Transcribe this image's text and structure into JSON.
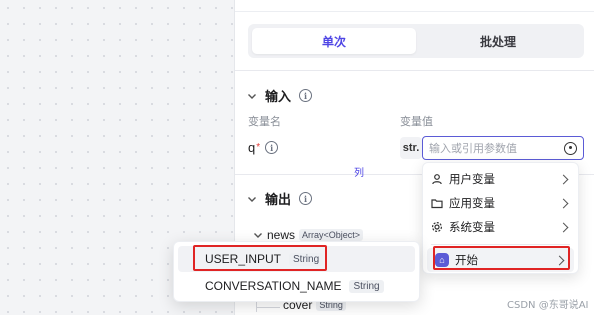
{
  "tabs": {
    "single": "单次",
    "batch": "批处理"
  },
  "input_section": {
    "title": "输入",
    "col_name": "变量名",
    "col_value": "变量值",
    "var_name": "q",
    "required_mark": "*",
    "type_chip": "str.",
    "placeholder": "输入或引用参数值"
  },
  "output_section": {
    "title": "输出",
    "partial_link": "列",
    "rows": [
      {
        "name": "news",
        "type": "Array<Object>"
      },
      {
        "name": "cover",
        "type": "String"
      }
    ]
  },
  "dropdown": {
    "items": [
      {
        "label": "用户变量",
        "icon": "user-icon"
      },
      {
        "label": "应用变量",
        "icon": "folder-icon"
      },
      {
        "label": "系统变量",
        "icon": "gear-icon"
      },
      {
        "label": "开始",
        "icon": "start-node-icon"
      }
    ]
  },
  "popover": {
    "items": [
      {
        "name": "USER_INPUT",
        "type": "String"
      },
      {
        "name": "CONVERSATION_NAME",
        "type": "String"
      }
    ]
  },
  "watermark": "CSDN @东哥说AI",
  "colors": {
    "accent": "#4f46e5",
    "highlight_box": "#e02424"
  }
}
